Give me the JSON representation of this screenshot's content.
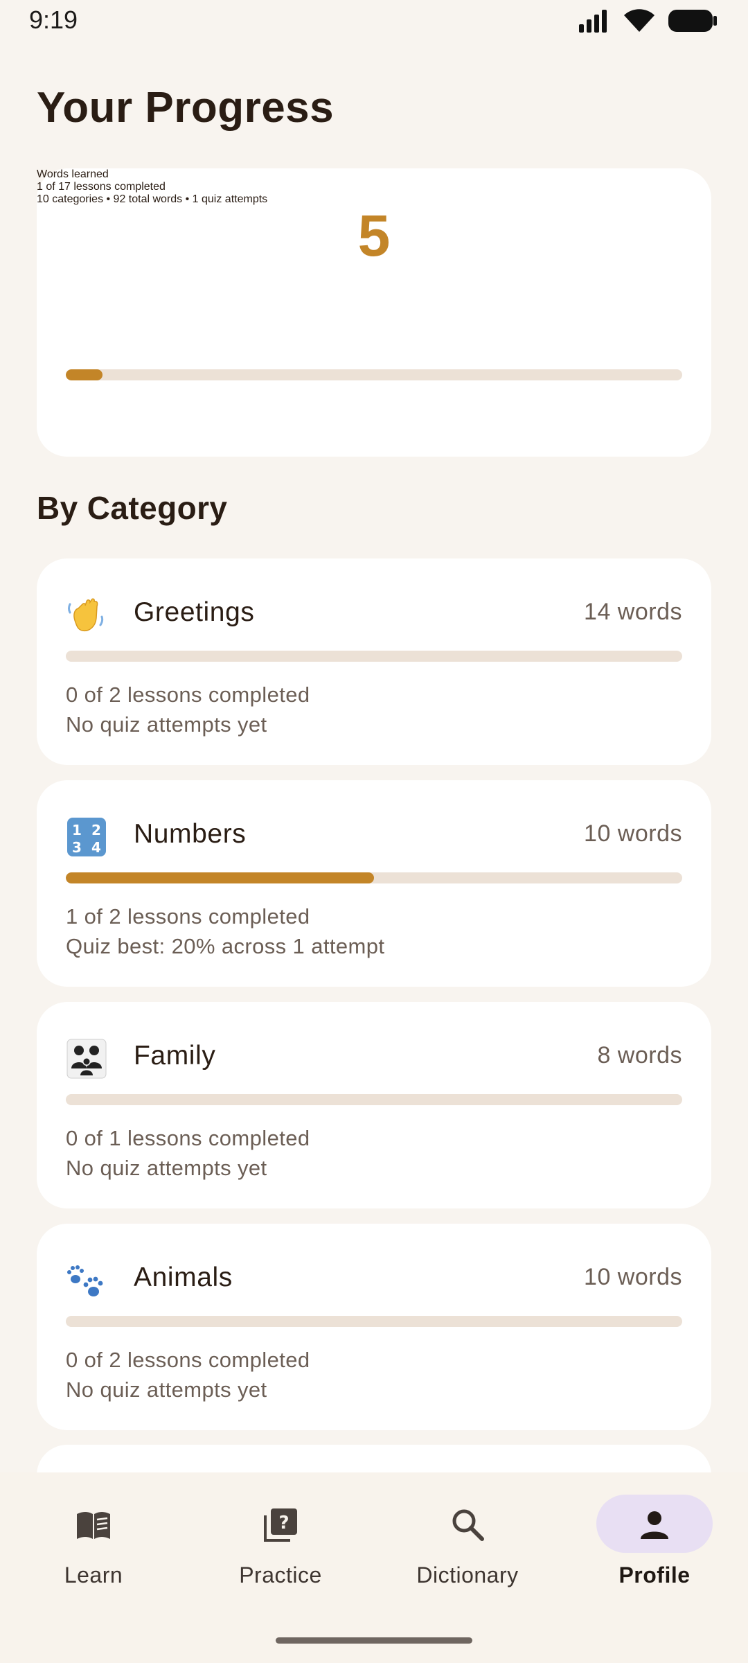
{
  "status_bar": {
    "time": "9:19"
  },
  "page": {
    "title": "Your Progress"
  },
  "summary": {
    "words_learned": "5",
    "words_learned_label": "Words learned",
    "lessons_text": "1 of 17 lessons completed",
    "progress_fraction": 0.06,
    "stats_text": "10 categories • 92 total words • 1 quiz attempts"
  },
  "by_category": {
    "title": "By Category",
    "items": [
      {
        "icon": "👋",
        "icon_name": "waving-hand-icon",
        "name": "Greetings",
        "count": "14 words",
        "progress_fraction": 0.0,
        "lessons": "0 of 2 lessons completed",
        "quiz": "No quiz attempts yet"
      },
      {
        "icon": "🔢",
        "icon_name": "numbers-input-icon",
        "name": "Numbers",
        "count": "10 words",
        "progress_fraction": 0.5,
        "lessons": "1 of 2 lessons completed",
        "quiz": "Quiz best: 20% across 1 attempt"
      },
      {
        "icon": "👨‍👩‍👧",
        "icon_name": "family-icon",
        "name": "Family",
        "count": "8 words",
        "progress_fraction": 0.0,
        "lessons": "0 of 1 lessons completed",
        "quiz": "No quiz attempts yet"
      },
      {
        "icon": "🐾",
        "icon_name": "paw-prints-icon",
        "name": "Animals",
        "count": "10 words",
        "progress_fraction": 0.0,
        "lessons": "0 of 2 lessons completed",
        "quiz": "No quiz attempts yet"
      }
    ]
  },
  "bottom_nav": {
    "items": [
      {
        "label": "Learn",
        "icon": "book-icon",
        "active": false
      },
      {
        "label": "Practice",
        "icon": "quiz-icon",
        "active": false
      },
      {
        "label": "Dictionary",
        "icon": "search-icon",
        "active": false
      },
      {
        "label": "Profile",
        "icon": "person-icon",
        "active": true
      }
    ]
  },
  "colors": {
    "background": "#f8f4ef",
    "accent": "#c38528",
    "track": "#ece1d6",
    "active_pill": "#e8dff3"
  }
}
